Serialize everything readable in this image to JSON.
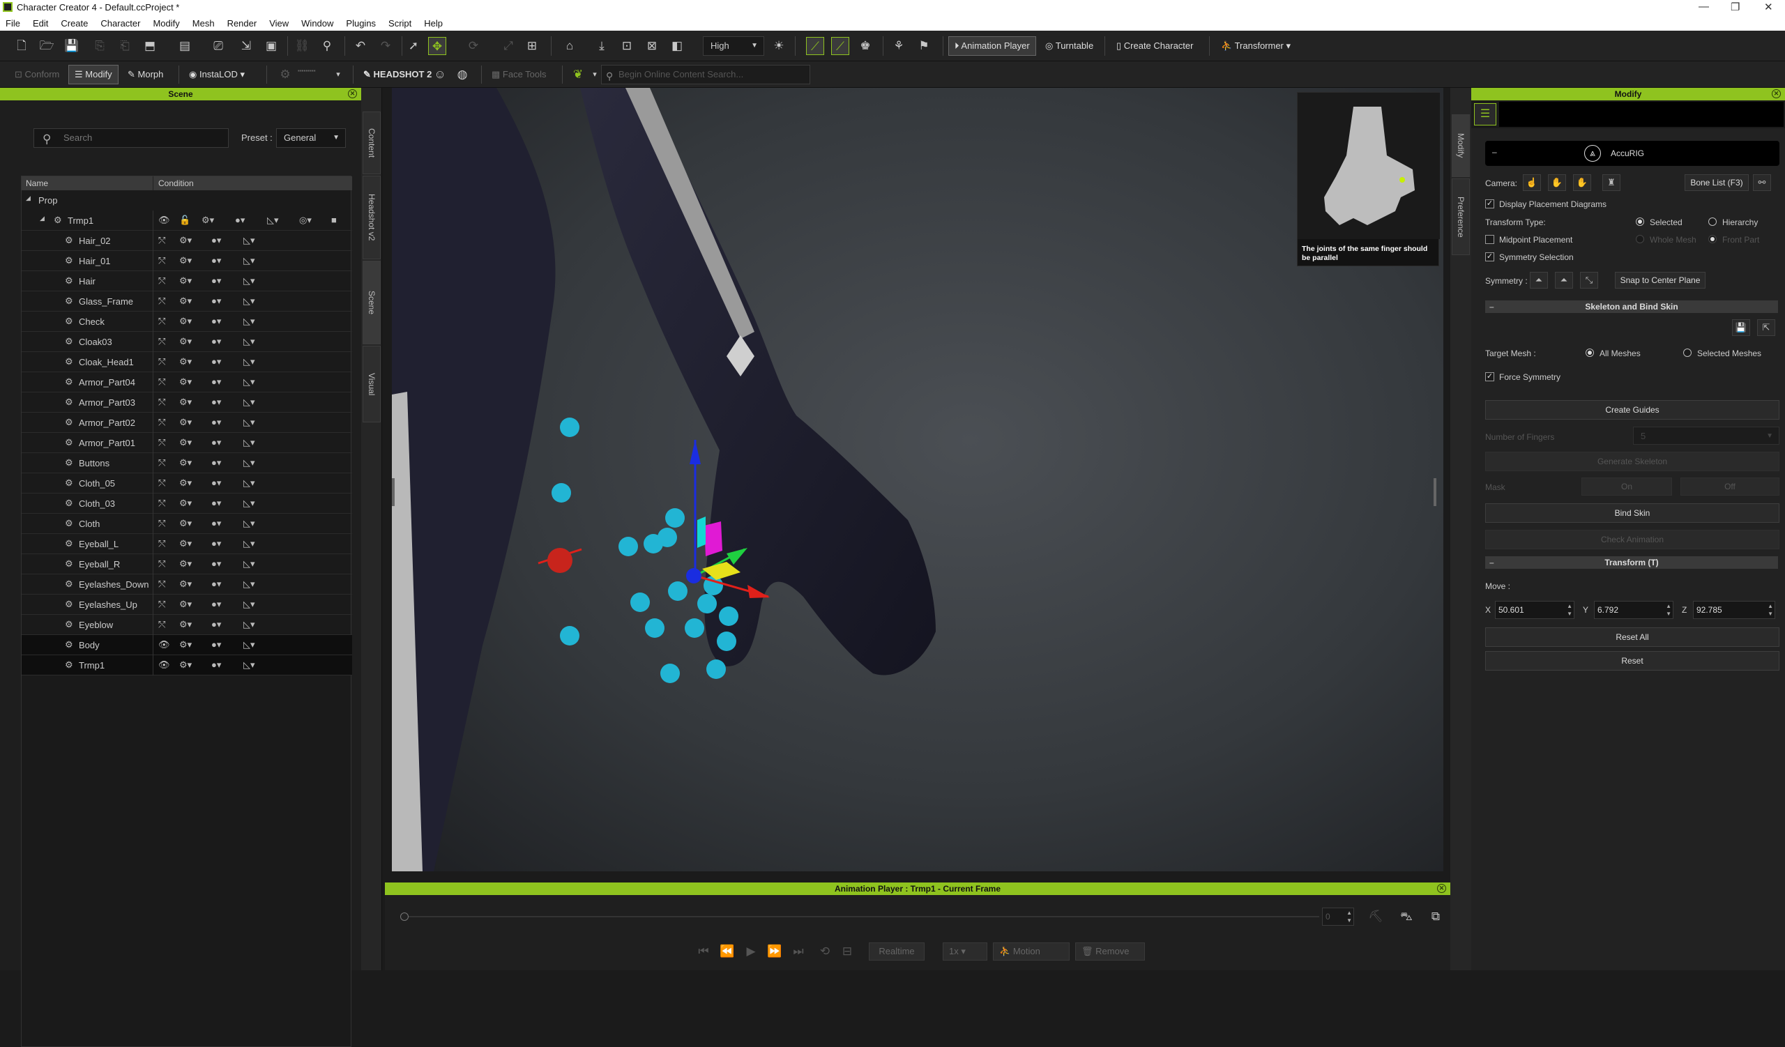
{
  "window": {
    "title": "Character Creator 4 - Default.ccProject *",
    "minimize": "—",
    "maximize": "❐",
    "close": "✕"
  },
  "menu": [
    "File",
    "Edit",
    "Create",
    "Character",
    "Modify",
    "Mesh",
    "Render",
    "View",
    "Window",
    "Plugins",
    "Script",
    "Help"
  ],
  "toolbar": {
    "quality": "High",
    "animation_player": "Animation Player",
    "turntable": "Turntable",
    "create_character": "Create Character",
    "transformer": "Transformer"
  },
  "toolbar2": {
    "conform": "Conform",
    "modify": "Modify",
    "morph": "Morph",
    "instalod": "InstaLOD",
    "headshot": "HEADSHOT 2",
    "face_tools": "Face Tools",
    "search_placeholder": "Begin Online Content Search..."
  },
  "scene": {
    "title": "Scene",
    "search_placeholder": "Search",
    "preset_label": "Preset :",
    "preset_value": "General",
    "col_name": "Name",
    "col_condition": "Condition",
    "root": "Prop",
    "group": "Trmp1",
    "items": [
      "Hair_02",
      "Hair_01",
      "Hair",
      "Glass_Frame",
      "Check",
      "Cloak03",
      "Cloak_Head1",
      "Armor_Part04",
      "Armor_Part03",
      "Armor_Part02",
      "Armor_Part01",
      "Buttons",
      "Cloth_05",
      "Cloth_03",
      "Cloth",
      "Eyeball_L",
      "Eyeball_R",
      "Eyelashes_Down",
      "Eyelashes_Up",
      "Eyeblow"
    ],
    "bottom": [
      "Body",
      "Trmp1"
    ]
  },
  "left_tabs": [
    "Content",
    "Headshot v2",
    "Scene",
    "Visual"
  ],
  "right_tabs": [
    "Modify",
    "Preference"
  ],
  "viewport": {
    "hint": "The joints of the same finger should be parallel"
  },
  "anim": {
    "title": "Animation Player : Trmp1 - Current Frame",
    "frame": "0",
    "realtime": "Realtime",
    "speed": "1x",
    "motion": "Motion",
    "remove": "Remove"
  },
  "modify": {
    "title": "Modify",
    "accurig": "AccuRIG",
    "camera": "Camera:",
    "bone_list": "Bone List (F3)",
    "display_placement": "Display Placement Diagrams",
    "transform_type": "Transform Type:",
    "selected": "Selected",
    "hierarchy": "Hierarchy",
    "midpoint": "Midpoint Placement",
    "whole_mesh": "Whole Mesh",
    "front_part": "Front Part",
    "symmetry_selection": "Symmetry Selection",
    "symmetry": "Symmetry :",
    "snap_center": "Snap to Center Plane",
    "skeleton_section": "Skeleton and Bind Skin",
    "target_mesh": "Target Mesh :",
    "all_meshes": "All Meshes",
    "selected_meshes": "Selected Meshes",
    "force_symmetry": "Force Symmetry",
    "create_guides": "Create Guides",
    "num_fingers": "Number of Fingers",
    "num_fingers_val": "5",
    "generate_skeleton": "Generate Skeleton",
    "mask": "Mask",
    "on": "On",
    "off": "Off",
    "bind_skin": "Bind Skin",
    "check_animation": "Check Animation",
    "transform_section": "Transform (T)",
    "move": "Move :",
    "x_label": "X",
    "x": "50.601",
    "y_label": "Y",
    "y": "6.792",
    "z_label": "Z",
    "z": "92.785",
    "reset_all": "Reset All",
    "reset": "Reset"
  },
  "colors": {
    "accent": "#8fc31f",
    "joint": "#22b5d4",
    "axis_x": "#e0201a",
    "axis_y": "#1a2de0",
    "axis_z": "#1fd040"
  }
}
